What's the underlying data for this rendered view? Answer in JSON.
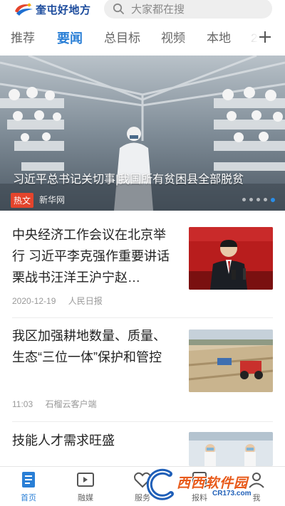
{
  "header": {
    "logo_text": "奎屯好地方",
    "search_placeholder": "大家都在搜"
  },
  "tabs": [
    {
      "label": "推荐"
    },
    {
      "label": "要闻"
    },
    {
      "label": "总目标"
    },
    {
      "label": "视频"
    },
    {
      "label": "本地"
    },
    {
      "label": "2"
    }
  ],
  "active_tab": "要闻",
  "banner": {
    "title": "习近平总书记关切事|我国所有贫困县全部脱贫",
    "tag": "热文",
    "source": "新华网"
  },
  "news": [
    {
      "title": "中央经济工作会议在北京举行 习近平李克强作重要讲话 栗战书汪洋王沪宁赵…",
      "date": "2020-12-19",
      "source": "人民日报"
    },
    {
      "title": "我区加强耕地数量、质量、生态“三位一体”保护和管控",
      "date": "11:03",
      "source": "石榴云客户端"
    },
    {
      "title": "技能人才需求旺盛"
    }
  ],
  "bottom_nav": [
    {
      "label": "首页"
    },
    {
      "label": "融媒"
    },
    {
      "label": "服务"
    },
    {
      "label": "报料"
    },
    {
      "label": "我"
    }
  ],
  "watermark": {
    "text": "西西软件园",
    "url": "CR173.com"
  },
  "colors": {
    "accent": "#2a7fd6",
    "hot_tag": "#e4442c",
    "logo": "#1a4a9c"
  }
}
